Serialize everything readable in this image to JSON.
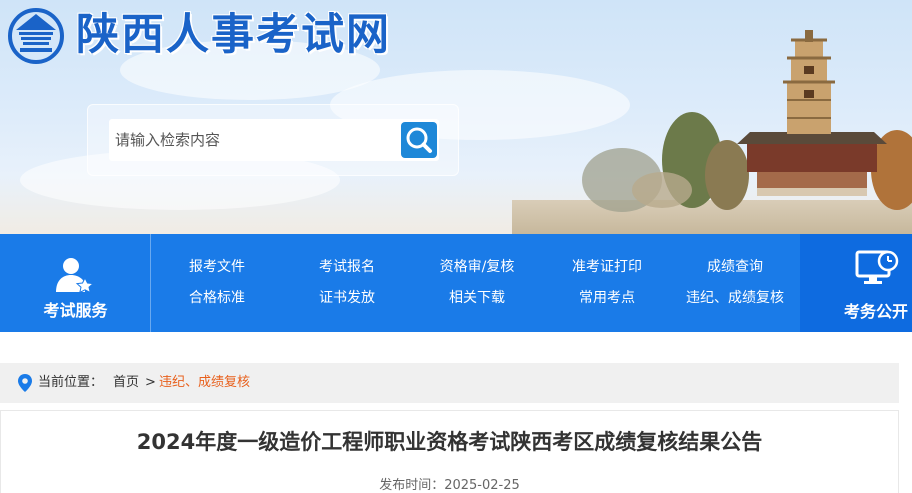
{
  "header": {
    "site_title": "陕西人事考试网",
    "search": {
      "placeholder": "请输入检索内容"
    }
  },
  "nav": {
    "left_label": "考试服务",
    "right_label": "考务公开",
    "links": [
      [
        "报考文件",
        "考试报名",
        "资格审/复核",
        "准考证打印",
        "成绩查询"
      ],
      [
        "合格标准",
        "证书发放",
        "相关下载",
        "常用考点",
        "违纪、成绩复核"
      ]
    ]
  },
  "breadcrumb": {
    "prefix": "当前位置：",
    "home": "首页",
    "separator": ">",
    "current": "违纪、成绩复核"
  },
  "article": {
    "title": "2024年度一级造价工程师职业资格考试陕西考区成绩复核结果公告",
    "date_label": "发布时间：",
    "date": "2025-02-25"
  },
  "colors": {
    "nav_blue": "#1a7be8",
    "nav_blue_dark": "#0e6be0",
    "title_blue": "#1a63c8",
    "breadcrumb_current": "#e8601c"
  }
}
